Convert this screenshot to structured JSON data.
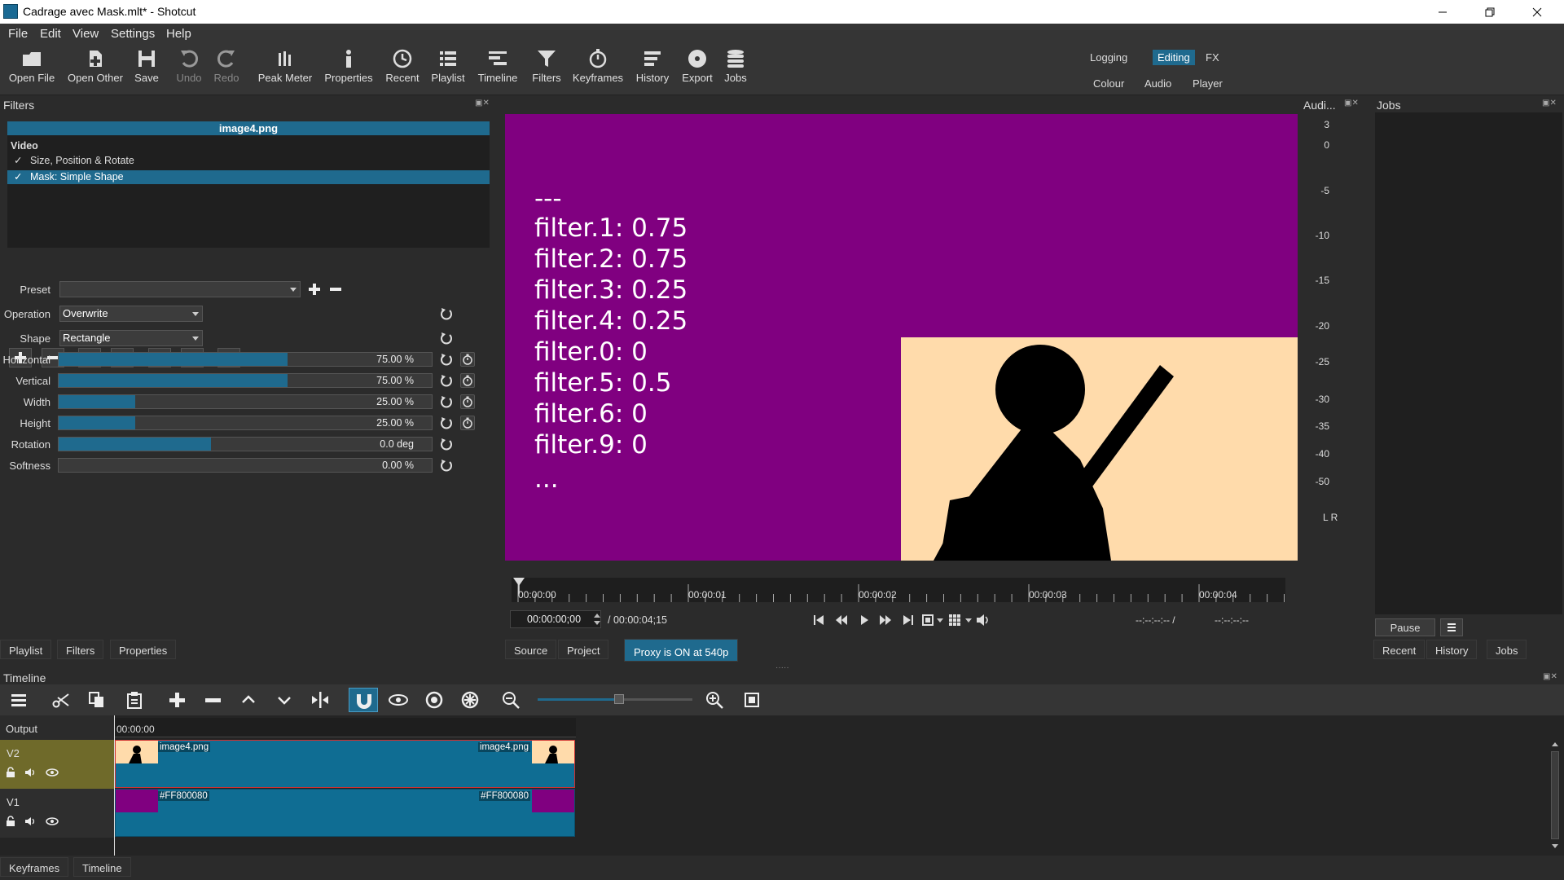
{
  "window": {
    "title": "Cadrage avec Mask.mlt* - Shotcut"
  },
  "menu": [
    "File",
    "Edit",
    "View",
    "Settings",
    "Help"
  ],
  "toolbar": {
    "open_file": "Open File",
    "open_other": "Open Other",
    "save": "Save",
    "undo": "Undo",
    "redo": "Redo",
    "peak_meter": "Peak Meter",
    "properties": "Properties",
    "recent": "Recent",
    "playlist": "Playlist",
    "timeline": "Timeline",
    "filters": "Filters",
    "keyframes": "Keyframes",
    "history": "History",
    "export": "Export",
    "jobs": "Jobs"
  },
  "layouts": {
    "logging": "Logging",
    "editing": "Editing",
    "fx": "FX",
    "colour": "Colour",
    "audio": "Audio",
    "player": "Player"
  },
  "filters_panel": {
    "title": "Filters",
    "clip_name": "image4.png",
    "section": "Video",
    "items": [
      {
        "label": "Size, Position & Rotate",
        "checked": "✓"
      },
      {
        "label": "Mask: Simple Shape",
        "checked": "✓"
      }
    ],
    "preset_label": "Preset",
    "preset_value": "",
    "operation_label": "Operation",
    "operation_value": "Overwrite",
    "shape_label": "Shape",
    "shape_value": "Rectangle",
    "params": [
      {
        "label": "Horizontal",
        "value": "75.00 %",
        "fill": 0.75
      },
      {
        "label": "Vertical",
        "value": "75.00 %",
        "fill": 0.75
      },
      {
        "label": "Width",
        "value": "25.00 %",
        "fill": 0.25
      },
      {
        "label": "Height",
        "value": "25.00 %",
        "fill": 0.25
      },
      {
        "label": "Rotation",
        "value": "0.0 deg",
        "fill": 0.5
      },
      {
        "label": "Softness",
        "value": "0.00 %",
        "fill": 0
      }
    ]
  },
  "left_tabs": [
    "Playlist",
    "Filters",
    "Properties"
  ],
  "preview": {
    "lines": [
      "---",
      "filter.1: 0.75",
      "filter.2: 0.75",
      "filter.3: 0.25",
      "filter.4: 0.25",
      "filter.0: 0",
      "filter.5: 0.5",
      "filter.6: 0",
      "filter.9: 0",
      "..."
    ],
    "bg_color": "#800080",
    "image_bg": "#ffdbab"
  },
  "ruler": {
    "labels": [
      "00:00:00",
      "00:00:01",
      "00:00:02",
      "00:00:03",
      "00:00:04"
    ]
  },
  "transport": {
    "position": "00:00:00;00",
    "duration": "/ 00:00:04;15",
    "in_point": "--:--:--:-- /",
    "out_point": "--:--:--:--"
  },
  "preview_tabs": {
    "source": "Source",
    "project": "Project",
    "proxy": "Proxy is ON at 540p"
  },
  "audio_panel": {
    "title": "Audi...",
    "ticks": [
      "3",
      "0",
      "-5",
      "-10",
      "-15",
      "-20",
      "-25",
      "-30",
      "-35",
      "-40",
      "-50"
    ],
    "lr": "L R"
  },
  "jobs_panel": {
    "title": "Jobs",
    "pause": "Pause",
    "tabs": [
      "Recent",
      "History",
      "Jobs"
    ]
  },
  "timeline": {
    "title": "Timeline",
    "output_label": "Output",
    "timecode": "00:00:00",
    "tracks": [
      {
        "name": "V2",
        "clip_start": "image4.png",
        "clip_end": "image4.png"
      },
      {
        "name": "V1",
        "clip_start": "#FF800080",
        "clip_end": "#FF800080"
      }
    ]
  },
  "bottom_tabs": [
    "Keyframes",
    "Timeline"
  ]
}
